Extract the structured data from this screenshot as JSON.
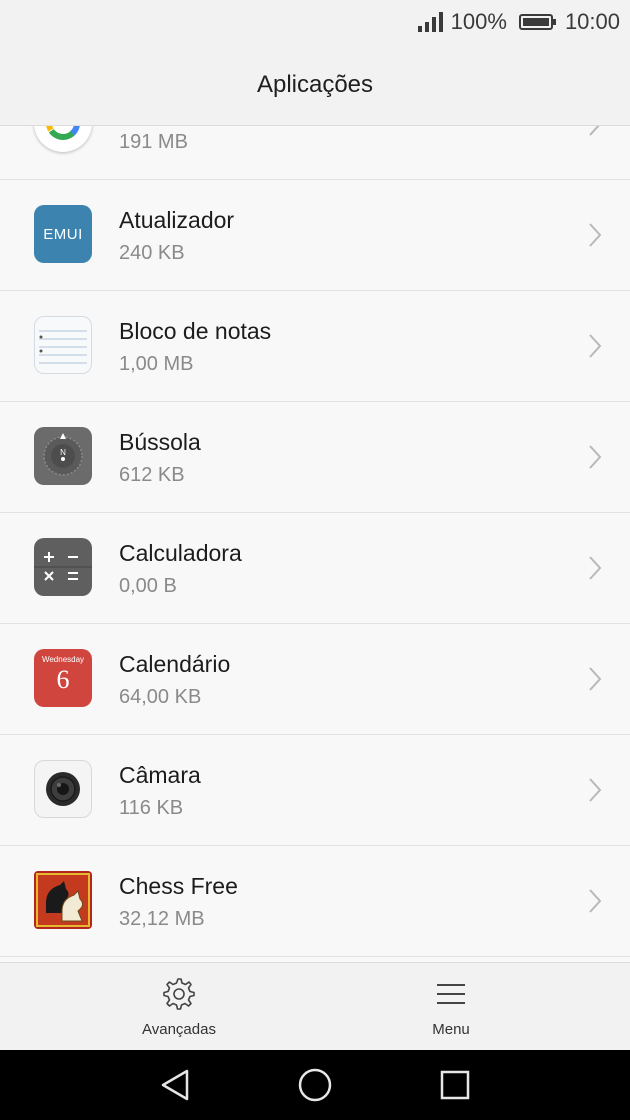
{
  "status_bar": {
    "battery_percent": "100%",
    "time": "10:00"
  },
  "header": {
    "title": "Aplicações"
  },
  "apps": [
    {
      "name": "",
      "size": "191 MB",
      "icon": "google-icon"
    },
    {
      "name": "Atualizador",
      "size": "240 KB",
      "icon": "emui-icon",
      "icon_text": "EMUI"
    },
    {
      "name": "Bloco de notas",
      "size": "1,00 MB",
      "icon": "notepad-icon"
    },
    {
      "name": "Bússola",
      "size": "612 KB",
      "icon": "compass-icon",
      "icon_text": "N"
    },
    {
      "name": "Calculadora",
      "size": "0,00 B",
      "icon": "calculator-icon"
    },
    {
      "name": "Calendário",
      "size": "64,00 KB",
      "icon": "calendar-icon",
      "icon_day": "Wednesday",
      "icon_date": "6"
    },
    {
      "name": "Câmara",
      "size": "116 KB",
      "icon": "camera-icon"
    },
    {
      "name": "Chess Free",
      "size": "32,12 MB",
      "icon": "chess-icon"
    }
  ],
  "bottom_bar": {
    "advanced_label": "Avançadas",
    "menu_label": "Menu"
  },
  "colors": {
    "emui_blue": "#3c83b0",
    "calendar_red": "#d0463f",
    "compass_gray": "#6b6b6b",
    "calculator_gray": "#5f5f5f"
  }
}
